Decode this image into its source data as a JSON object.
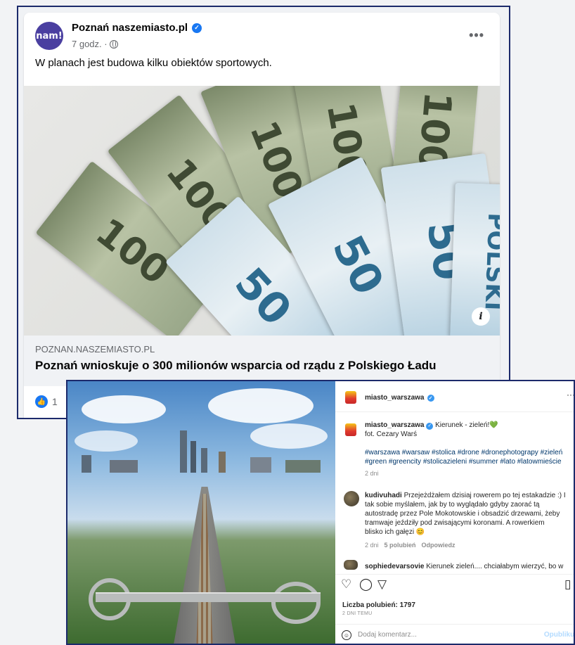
{
  "facebook": {
    "page_name": "Poznań naszemiasto.pl",
    "avatar_text": "nam!",
    "time": "7 godz. ·",
    "more": "•••",
    "post_text": "W planach jest budowa kilku obiektów sportowych.",
    "banknote_100": "100",
    "banknote_50": "50",
    "banknote_polski": "POLSKI",
    "info_icon": "i",
    "link_domain": "POZNAN.NASZEMIASTO.PL",
    "link_headline": "Poznań wnioskuje o 300 milionów wsparcia od rządu z Polskiego Ładu",
    "reaction_count": "1",
    "icons": [
      "verified-badge-icon",
      "globe-icon",
      "more-icon",
      "info-icon",
      "like-icon"
    ]
  },
  "instagram": {
    "account": "miasto_warszawa",
    "more": "···",
    "caption_user": "miasto_warszawa",
    "caption_text": "Kierunek - zieleń!💚",
    "photo_credit": "fot. Cezary Warś",
    "hashtags_line1": "#warszawa #warsaw #stolica #drone #dronephotograpy #zieleń",
    "hashtags_line2": "#green #greencity #stolicazieleni #summer #lato #latowmieście",
    "caption_age": "2 dni",
    "comments": [
      {
        "user": "kudivuhadi",
        "lines": [
          "Przejeżdżałem dzisiaj rowerem po tej estakadzie :) I",
          "tak sobie myślałem, jak by to wyglądało gdyby zaorać tą",
          "autostradę przez Pole Mokotowskie i obsadzić drzewami, żeby",
          "tramwaje jeździły pod zwisającymi koronami. A rowerkiem",
          "blisko ich gałęzi 😊"
        ],
        "age": "2 dni",
        "likes": "5 polubień",
        "reply": "Odpowiedz"
      },
      {
        "user": "sophiedevarsovie",
        "lines": [
          "Kierunek zieleń.... chciałabym wierzyć, bo w"
        ]
      }
    ],
    "likes_label": "Liczba polubień: 1797",
    "date_label": "2 DNI TEMU",
    "add_comment_placeholder": "Dodaj komentarz...",
    "post_button": "Opublikuj",
    "icons": [
      "heart-icon",
      "comment-icon",
      "share-icon",
      "bookmark-icon",
      "smile-icon"
    ]
  }
}
